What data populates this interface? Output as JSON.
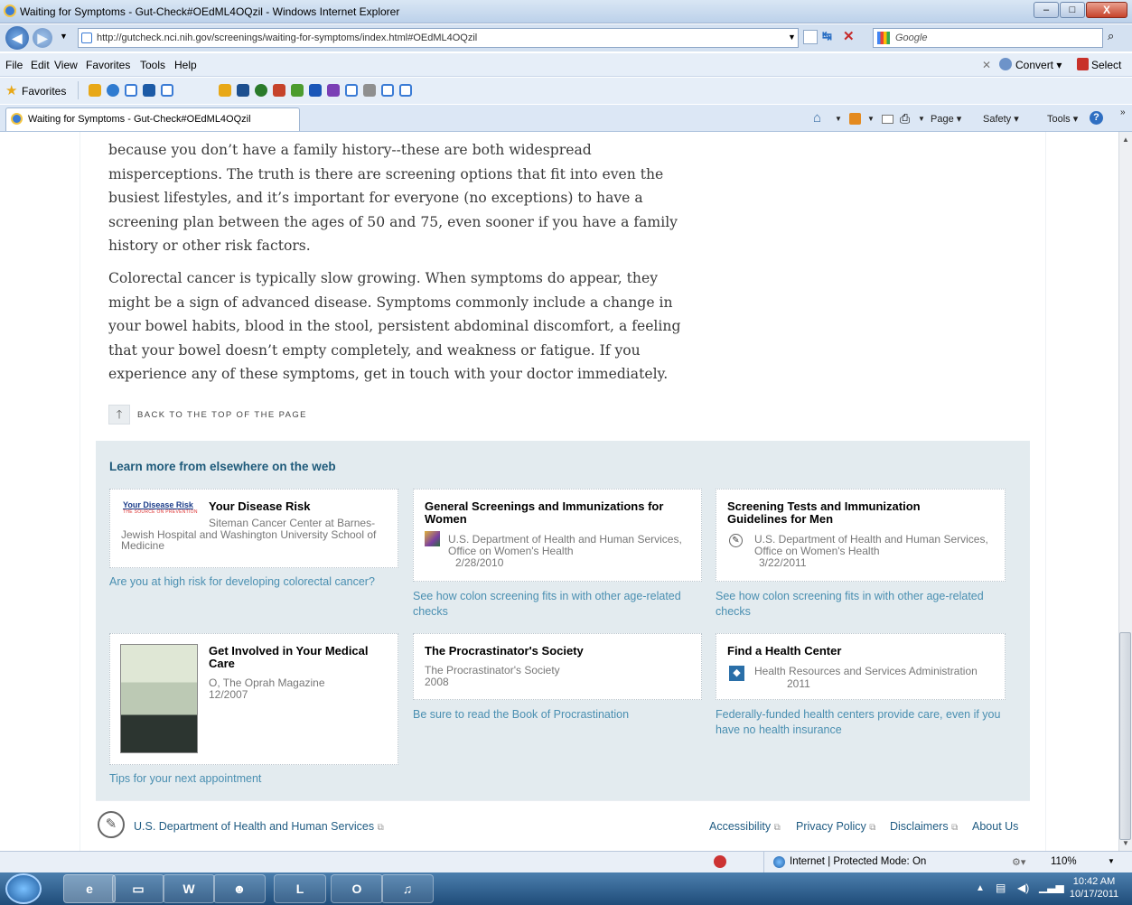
{
  "window": {
    "title": "Waiting for Symptoms - Gut-Check#OEdML4OQzil - Windows Internet Explorer",
    "min": "–",
    "max": "□",
    "close": "X"
  },
  "address": {
    "url": "http://gutcheck.nci.nih.gov/screenings/waiting-for-symptoms/index.html#OEdML4OQzil",
    "search_placeholder": "Google"
  },
  "menu": [
    "File",
    "Edit",
    "View",
    "Favorites",
    "Tools",
    "Help"
  ],
  "menu_right": {
    "convert": "Convert ▾",
    "select": "Select"
  },
  "favorites": {
    "label": "Favorites"
  },
  "tab": {
    "title": "Waiting for Symptoms - Gut-Check#OEdML4OQzil"
  },
  "commandbar": {
    "page": "Page ▾",
    "safety": "Safety ▾",
    "tools": "Tools ▾"
  },
  "content": {
    "para1": "because you don’t have a family history--these are both widespread misperceptions. The truth is there are screening options that fit into even the busiest lifestyles, and it’s important for everyone (no exceptions) to have a screening plan between the ages of 50 and 75, even sooner if you have a family history or other risk factors.",
    "para2": "Colorectal cancer is typically slow growing. When symptoms do appear, they might be a sign of advanced disease. Symptoms commonly include a change in your bowel habits, blood in the stool, persistent abdominal discomfort, a feeling that your bowel doesn’t empty completely, and weakness or fatigue. If you experience any of these symptoms, get in touch with your doctor immediately.",
    "back_to_top": "BACK TO THE TOP OF THE PAGE"
  },
  "learn_more": {
    "heading": "Learn more from elsewhere on the web",
    "cards": [
      {
        "logo": "Your Disease Risk",
        "logo_sub": "THE SOURCE ON PREVENTION",
        "title": "Your Disease Risk",
        "source": "Siteman Cancer Center at Barnes-Jewish Hospital and Washington University School of Medicine",
        "date": "",
        "link": "Are you at high risk for developing colorectal cancer?"
      },
      {
        "title": "General Screenings and Immunizations for Women",
        "source": "U.S. Department of Health and Human Services, Office on Women's Health",
        "date": "2/28/2010",
        "link": "See how colon screening fits in with other age-related checks"
      },
      {
        "title": "Screening Tests and Immunization Guidelines for Men",
        "source": "U.S. Department of Health and Human Services, Office on Women's Health",
        "date": "3/22/2011",
        "link": "See how colon screening fits in with other age-related checks"
      },
      {
        "title": "Get Involved in Your Medical Care",
        "source": "O, The Oprah Magazine",
        "date": "12/2007",
        "link": "Tips for your next appointment"
      },
      {
        "title": "The Procrastinator's Society",
        "source": "The Procrastinator's Society",
        "date": "2008",
        "link": "Be sure to read the Book of Procrastination"
      },
      {
        "title": "Find a Health Center",
        "source": "Health Resources and Services Administration",
        "date": "2011",
        "link": "Federally-funded health centers provide care, even if you have no health insurance"
      }
    ]
  },
  "footer": {
    "hhs": "U.S. Department of Health and Human Services",
    "links": [
      "Accessibility",
      "Privacy Policy",
      "Disclaimers",
      "About Us"
    ]
  },
  "status": {
    "zone": "Internet | Protected Mode: On",
    "zoom": "110%"
  },
  "taskbar": {
    "time": "10:42 AM",
    "date": "10/17/2011"
  }
}
